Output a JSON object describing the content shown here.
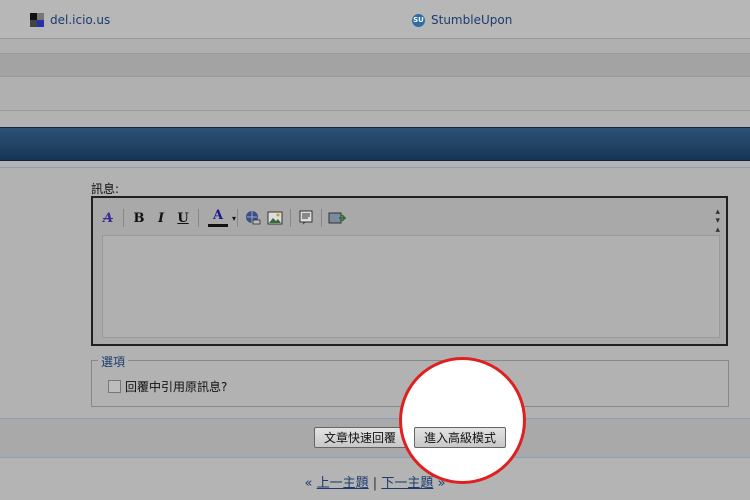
{
  "social": {
    "delicious": "del.icio.us",
    "stumbleupon": "StumbleUpon",
    "stumbleupon_icon_text": "SU"
  },
  "editor": {
    "label": "訊息:",
    "tools": [
      {
        "name": "remove-format-icon",
        "glyph": "A"
      },
      {
        "name": "bold-icon",
        "glyph": "B"
      },
      {
        "name": "italic-icon",
        "glyph": "I"
      },
      {
        "name": "underline-icon",
        "glyph": "U"
      },
      {
        "name": "font-color-icon",
        "glyph": "A"
      },
      {
        "name": "insert-link-icon",
        "glyph": "🌐"
      },
      {
        "name": "insert-image-icon",
        "glyph": "🖼"
      },
      {
        "name": "quote-icon",
        "glyph": "💬"
      },
      {
        "name": "switch-mode-icon",
        "glyph": "⇄"
      }
    ],
    "resize_glyph": "⇕"
  },
  "options": {
    "legend": "選項",
    "quote_label": "回覆中引用原訊息?",
    "quote_checked": false
  },
  "buttons": {
    "quick_reply": "文章快速回覆",
    "advanced": "進入高級模式"
  },
  "pager": {
    "prev_arrow": "«",
    "prev": "上一主題",
    "divider": "|",
    "next": "下一主題",
    "next_arrow": "»"
  },
  "colors": {
    "accent_link": "#1c3b6e",
    "titlebar": "#1f4068",
    "highlight_circle": "#e02020"
  }
}
